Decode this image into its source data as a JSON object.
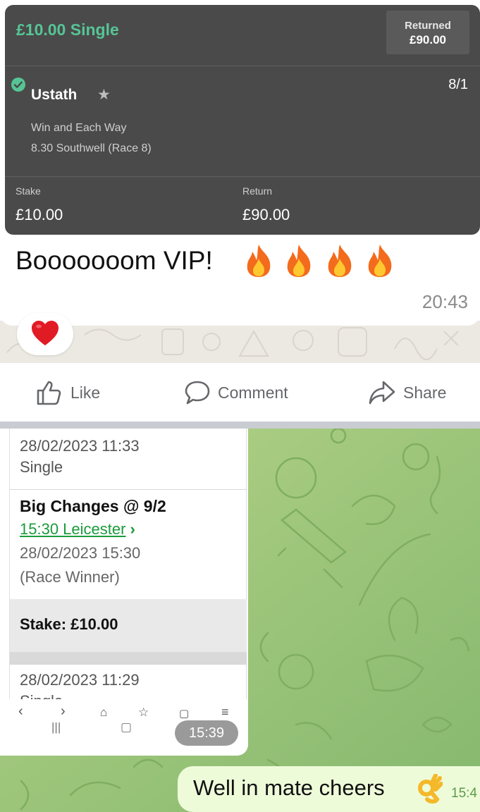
{
  "whatsapp": {
    "bet_slip": {
      "title": "£10.00 Single",
      "returned_label": "Returned",
      "returned_value": "£90.00",
      "runner": "Ustath",
      "odds": "8/1",
      "bet_type": "Win and Each Way",
      "race": "8.30 Southwell (Race 8)",
      "stake_label": "Stake",
      "stake_value": "£10.00",
      "return_label": "Return",
      "return_value": "£90.00"
    },
    "message_text": "Booooooom VIP!",
    "message_time": "20:43",
    "reaction": "heart"
  },
  "facebook_actions": {
    "like": "Like",
    "comment": "Comment",
    "share": "Share"
  },
  "telegram": {
    "screenshot": {
      "entry1_datetime": "28/02/2023 11:33",
      "entry1_type": "Single",
      "selection": "Big Changes @ 9/2",
      "race_link": "15:30 Leicester",
      "race_chevron": "›",
      "race_time": "28/02/2023 15:30",
      "market": "(Race Winner)",
      "stake": "Stake: £10.00",
      "entry2_datetime": "28/02/2023 11:29",
      "entry2_type": "Single",
      "timestamp": "15:39"
    },
    "reply": {
      "text": "Well in mate cheers",
      "time": "15:4"
    }
  },
  "colors": {
    "slip_bg": "#4a4a4a",
    "slip_accent": "#56c596",
    "telegram_bg": "#9cc57a",
    "reply_bubble": "#eefbd9",
    "link_green": "#1a9b3c"
  }
}
